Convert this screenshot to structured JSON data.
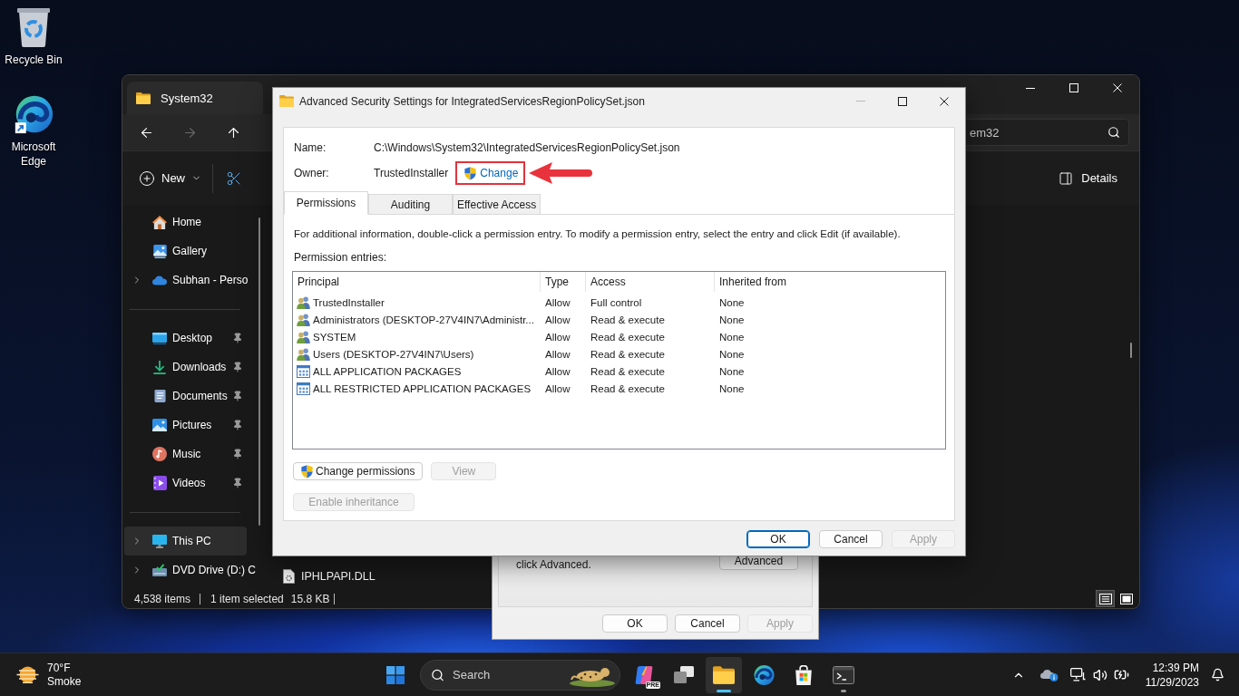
{
  "desktop": {
    "icons": [
      {
        "kind": "recycle-bin",
        "label": "Recycle Bin"
      },
      {
        "kind": "edge",
        "label": "Microsoft Edge"
      }
    ]
  },
  "explorer": {
    "tab_title": "System32",
    "nav_buttons": [
      {
        "kind": "back",
        "disabled": false
      },
      {
        "kind": "forward",
        "disabled": true
      },
      {
        "kind": "up",
        "disabled": false
      }
    ],
    "search": {
      "placeholder": "em32"
    },
    "toolbar": {
      "new_label": "New",
      "details_label": "Details"
    },
    "sidebar": {
      "sections": [
        {
          "items": [
            {
              "kind": "home",
              "label": "Home",
              "expandable": false,
              "pinned": false,
              "selected": false
            },
            {
              "kind": "gallery",
              "label": "Gallery",
              "expandable": false,
              "pinned": false,
              "selected": false
            },
            {
              "kind": "cloud",
              "label": "Subhan - Perso",
              "expandable": true,
              "pinned": false,
              "selected": false
            }
          ]
        },
        {
          "items": [
            {
              "kind": "desktop",
              "label": "Desktop",
              "expandable": false,
              "pinned": true,
              "selected": false
            },
            {
              "kind": "downloads",
              "label": "Downloads",
              "expandable": false,
              "pinned": true,
              "selected": false
            },
            {
              "kind": "documents",
              "label": "Documents",
              "expandable": false,
              "pinned": true,
              "selected": false
            },
            {
              "kind": "pictures",
              "label": "Pictures",
              "expandable": false,
              "pinned": true,
              "selected": false
            },
            {
              "kind": "music",
              "label": "Music",
              "expandable": false,
              "pinned": true,
              "selected": false
            },
            {
              "kind": "videos",
              "label": "Videos",
              "expandable": false,
              "pinned": true,
              "selected": false
            }
          ]
        },
        {
          "items": [
            {
              "kind": "pc",
              "label": "This PC",
              "expandable": true,
              "pinned": false,
              "selected": true
            },
            {
              "kind": "dvd",
              "label": "DVD Drive (D:) C",
              "expandable": true,
              "pinned": false,
              "selected": false
            }
          ]
        }
      ]
    },
    "files": [
      {
        "name": "IPHLPAPI.DLL"
      }
    ],
    "status_bar": {
      "item_count": "4,538 items",
      "selection": "1 item selected",
      "size": "15.8 KB"
    },
    "view_buttons": [
      {
        "kind": "details",
        "selected": true
      },
      {
        "kind": "tiles",
        "selected": false
      }
    ]
  },
  "properties_dialog": {
    "text": "click Advanced.",
    "advanced_button": "Advanced",
    "buttons": [
      {
        "label": "OK",
        "disabled": false
      },
      {
        "label": "Cancel",
        "disabled": false
      },
      {
        "label": "Apply",
        "disabled": true
      }
    ]
  },
  "security_dialog": {
    "title": "Advanced Security Settings for IntegratedServicesRegionPolicySet.json",
    "window_controls": [
      {
        "kind": "minimize",
        "disabled": true
      },
      {
        "kind": "maximize",
        "disabled": false
      },
      {
        "kind": "close",
        "disabled": false
      }
    ],
    "name": {
      "label": "Name:",
      "value": "C:\\Windows\\System32\\IntegratedServicesRegionPolicySet.json"
    },
    "owner": {
      "label": "Owner:",
      "value": "TrustedInstaller",
      "change_link": {
        "label": "Change",
        "highlighted": true
      }
    },
    "tabs": [
      {
        "label": "Permissions",
        "selected": true
      },
      {
        "label": "Auditing",
        "selected": false
      },
      {
        "label": "Effective Access",
        "selected": false
      }
    ],
    "info_text": "For additional information, double-click a permission entry. To modify a permission entry, select the entry and click Edit (if available).",
    "entries_label": "Permission entries:",
    "table": {
      "columns": [
        "Principal",
        "Type",
        "Access",
        "Inherited from"
      ],
      "rows": [
        {
          "kind": "user",
          "principal": "TrustedInstaller",
          "type": "Allow",
          "access": "Full control",
          "inherited_from": "None"
        },
        {
          "kind": "user",
          "principal": "Administrators (DESKTOP-27V4IN7\\Administr...",
          "type": "Allow",
          "access": "Read & execute",
          "inherited_from": "None"
        },
        {
          "kind": "user",
          "principal": "SYSTEM",
          "type": "Allow",
          "access": "Read & execute",
          "inherited_from": "None"
        },
        {
          "kind": "user",
          "principal": "Users (DESKTOP-27V4IN7\\Users)",
          "type": "Allow",
          "access": "Read & execute",
          "inherited_from": "None"
        },
        {
          "kind": "package",
          "principal": "ALL APPLICATION PACKAGES",
          "type": "Allow",
          "access": "Read & execute",
          "inherited_from": "None"
        },
        {
          "kind": "package",
          "principal": "ALL RESTRICTED APPLICATION PACKAGES",
          "type": "Allow",
          "access": "Read & execute",
          "inherited_from": "None"
        }
      ]
    },
    "entry_buttons": [
      {
        "label": "Change permissions",
        "shield": true,
        "disabled": false
      },
      {
        "label": "View",
        "shield": false,
        "disabled": true
      }
    ],
    "inheritance_button": {
      "label": "Enable inheritance",
      "disabled": true
    },
    "buttons": [
      {
        "label": "OK",
        "default": true,
        "disabled": false
      },
      {
        "label": "Cancel",
        "default": false,
        "disabled": false
      },
      {
        "label": "Apply",
        "default": false,
        "disabled": true
      }
    ]
  },
  "taskbar": {
    "weather": {
      "temperature": "70°F",
      "condition": "Smoke"
    },
    "search": {
      "placeholder": "Search"
    },
    "apps": [
      {
        "kind": "copilot",
        "badge": "PRE",
        "active": false,
        "running": false
      },
      {
        "kind": "task-view",
        "active": false,
        "running": false
      },
      {
        "kind": "explorer",
        "active": true,
        "running": true
      },
      {
        "kind": "edge",
        "active": false,
        "running": false
      },
      {
        "kind": "store",
        "active": false,
        "running": false
      },
      {
        "kind": "terminal",
        "active": false,
        "running": true
      }
    ],
    "clock": {
      "time": "12:39 PM",
      "date": "11/29/2023"
    }
  }
}
